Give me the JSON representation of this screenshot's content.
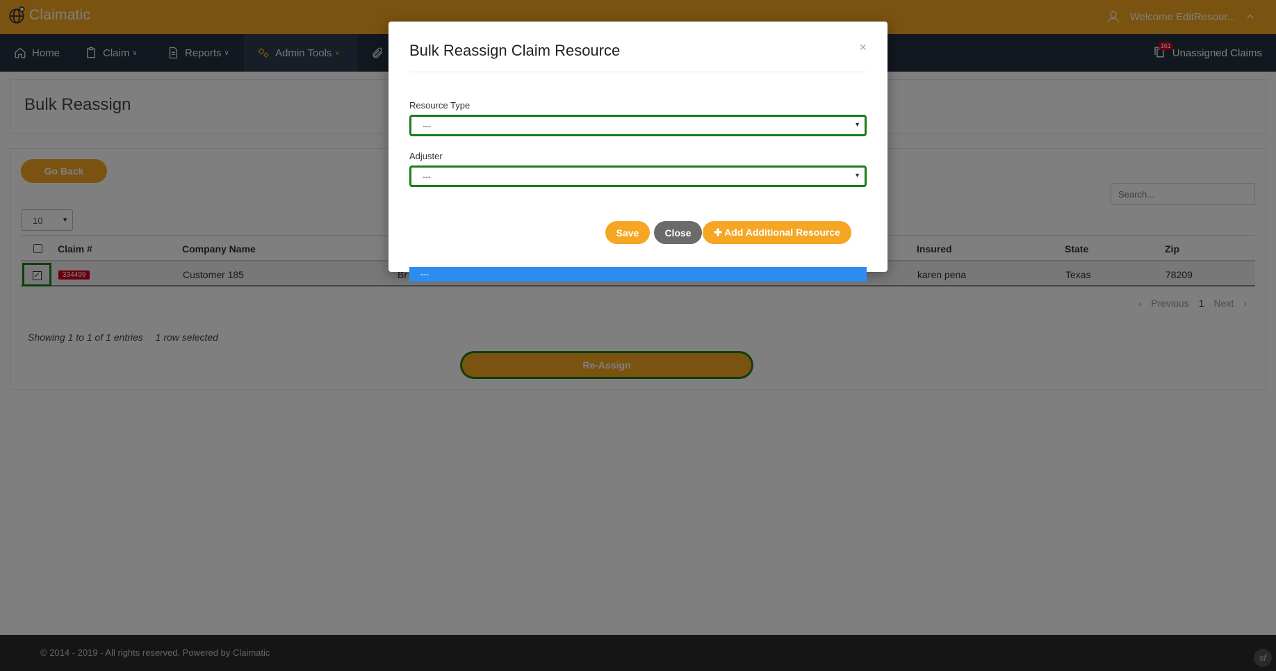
{
  "app": {
    "logo_text": "Claimatic",
    "welcome_text": "Welcome EditResour..."
  },
  "nav": {
    "items": [
      {
        "label": "Home",
        "icon": "home-icon"
      },
      {
        "label": "Claim",
        "icon": "clipboard-icon"
      },
      {
        "label": "Reports",
        "icon": "document-icon"
      },
      {
        "label": "Admin Tools",
        "icon": "gears-icon"
      },
      {
        "label": "",
        "icon": "paperclip-icon"
      }
    ],
    "unassigned_label": "Unassigned Claims",
    "unassigned_count": "161"
  },
  "page": {
    "title": "Bulk Reassign",
    "go_back_label": "Go Back",
    "search_placeholder": "Search...",
    "page_length": "10",
    "columns": [
      "Claim #",
      "Company Name",
      "Insured",
      "State",
      "Zip"
    ],
    "row": {
      "claim_no": "334499",
      "company": "Customer 185",
      "company_partial": "Br",
      "insured": "karen pena",
      "state": "Texas",
      "zip": "78209"
    },
    "pager": {
      "previous": "Previous",
      "current": "1",
      "next": "Next"
    },
    "info": "Showing 1 to 1 of 1 entries",
    "selected_info": "1 row selected",
    "reassign_label": "Re-Assign"
  },
  "modal": {
    "title": "Bulk Reassign Claim Resource",
    "close_symbol": "×",
    "resource_type_label": "Resource Type",
    "resource_type_value": "---",
    "adjuster_label": "Adjuster",
    "adjuster_value": "---",
    "save_label": "Save",
    "close_label": "Close",
    "add_label": "Add Additional Resource",
    "dropdown_option": "---"
  },
  "footer": {
    "text": "© 2014 - 2019 - All rights reserved. Powered by Claimatic",
    "sf_label": "sf"
  },
  "colors": {
    "brand": "#f5a623",
    "nav_bg": "#23303e",
    "focus_green": "#1a7d1a",
    "badge_red": "#d0021b",
    "option_blue": "#2d8cf0"
  }
}
